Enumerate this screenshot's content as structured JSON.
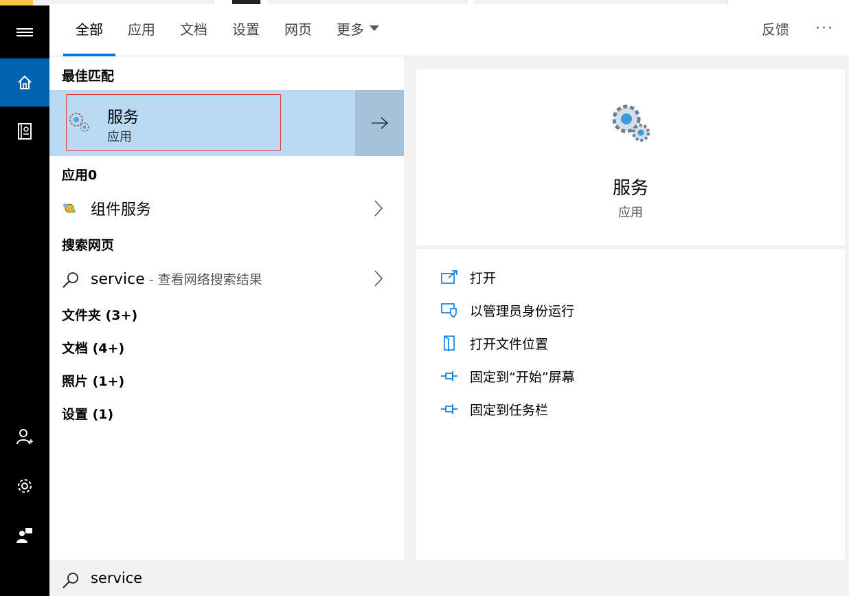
{
  "tabs": [
    {
      "label": "全部",
      "active": true
    },
    {
      "label": "应用"
    },
    {
      "label": "文档"
    },
    {
      "label": "设置"
    },
    {
      "label": "网页"
    },
    {
      "label": "更多"
    }
  ],
  "header": {
    "feedback": "反馈",
    "more": "···"
  },
  "colors": {
    "accent": "#0078d7",
    "selected_bg": "#b9daf2",
    "rail_active": "#0063b1",
    "highlight_box": "#e03a3a"
  },
  "results": {
    "best_match_heading": "最佳匹配",
    "best_match": {
      "title": "服务",
      "subtitle": "应用",
      "icon": "services-gears-icon"
    },
    "apps_heading": "应用0",
    "apps": [
      {
        "label": "组件服务",
        "icon": "component-services-icon"
      }
    ],
    "web_heading": "搜索网页",
    "web": {
      "query": "service",
      "hint": " - 查看网络搜索结果"
    },
    "categories": [
      {
        "label": "文件夹 (3+)"
      },
      {
        "label": "文档 (4+)"
      },
      {
        "label": "照片 (1+)"
      },
      {
        "label": "设置 (1)"
      }
    ]
  },
  "preview": {
    "title": "服务",
    "subtitle": "应用",
    "actions": [
      {
        "label": "打开",
        "icon": "open-icon"
      },
      {
        "label": "以管理员身份运行",
        "icon": "run-as-admin-icon"
      },
      {
        "label": "打开文件位置",
        "icon": "file-location-icon"
      },
      {
        "label": "固定到“开始”屏幕",
        "icon": "pin-icon"
      },
      {
        "label": "固定到任务栏",
        "icon": "pin-icon"
      }
    ]
  },
  "search": {
    "value": "service"
  }
}
